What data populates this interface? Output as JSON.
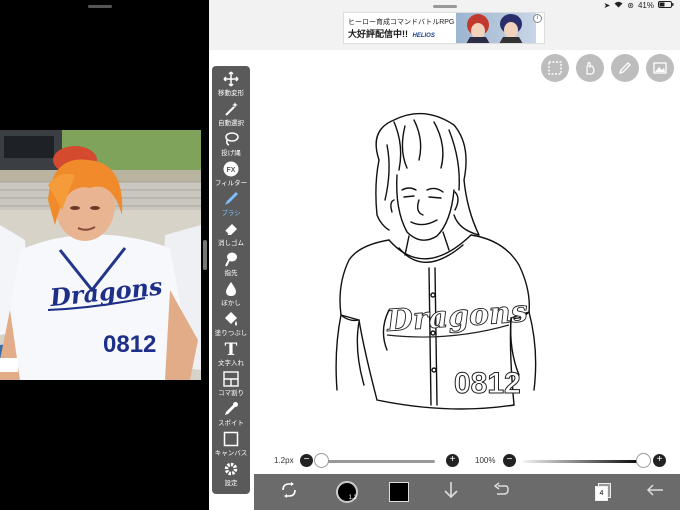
{
  "status_bar": {
    "battery": "41%"
  },
  "ad": {
    "line1": "ヒーロー育成コマンドバトルRPG",
    "line2": "大好評配信中!!",
    "logo": "HELIOS"
  },
  "tools": [
    {
      "label": "移動変形",
      "icon": "move-icon"
    },
    {
      "label": "自動選択",
      "icon": "magic-wand-icon"
    },
    {
      "label": "投げ縄",
      "icon": "lasso-icon"
    },
    {
      "label": "フィルター",
      "icon": "filter-icon",
      "glyph": "FX"
    },
    {
      "label": "ブラシ",
      "icon": "brush-icon",
      "active": true
    },
    {
      "label": "消しゴム",
      "icon": "eraser-icon"
    },
    {
      "label": "指先",
      "icon": "smudge-icon"
    },
    {
      "label": "ぼかし",
      "icon": "blur-icon"
    },
    {
      "label": "塗りつぶし",
      "icon": "fill-icon"
    },
    {
      "label": "文字入れ",
      "icon": "text-icon",
      "glyph": "T"
    },
    {
      "label": "コマ割り",
      "icon": "frame-divider-icon"
    },
    {
      "label": "スポイト",
      "icon": "eyedropper-icon"
    },
    {
      "label": "キャンバス",
      "icon": "canvas-icon"
    },
    {
      "label": "設定",
      "icon": "settings-icon"
    }
  ],
  "brush": {
    "size_label": "1.2px",
    "size_fraction": 0.02,
    "opacity_label": "100%",
    "opacity_fraction": 1.0
  },
  "bottom_bar": {
    "brush_size_badge": "1.2",
    "layer_count": "4",
    "current_color": "#000000"
  },
  "photo": {
    "jersey_text": "Dragons",
    "jersey_number": "0812"
  },
  "drawing": {
    "jersey_text": "Dragons",
    "jersey_number": "0812"
  }
}
